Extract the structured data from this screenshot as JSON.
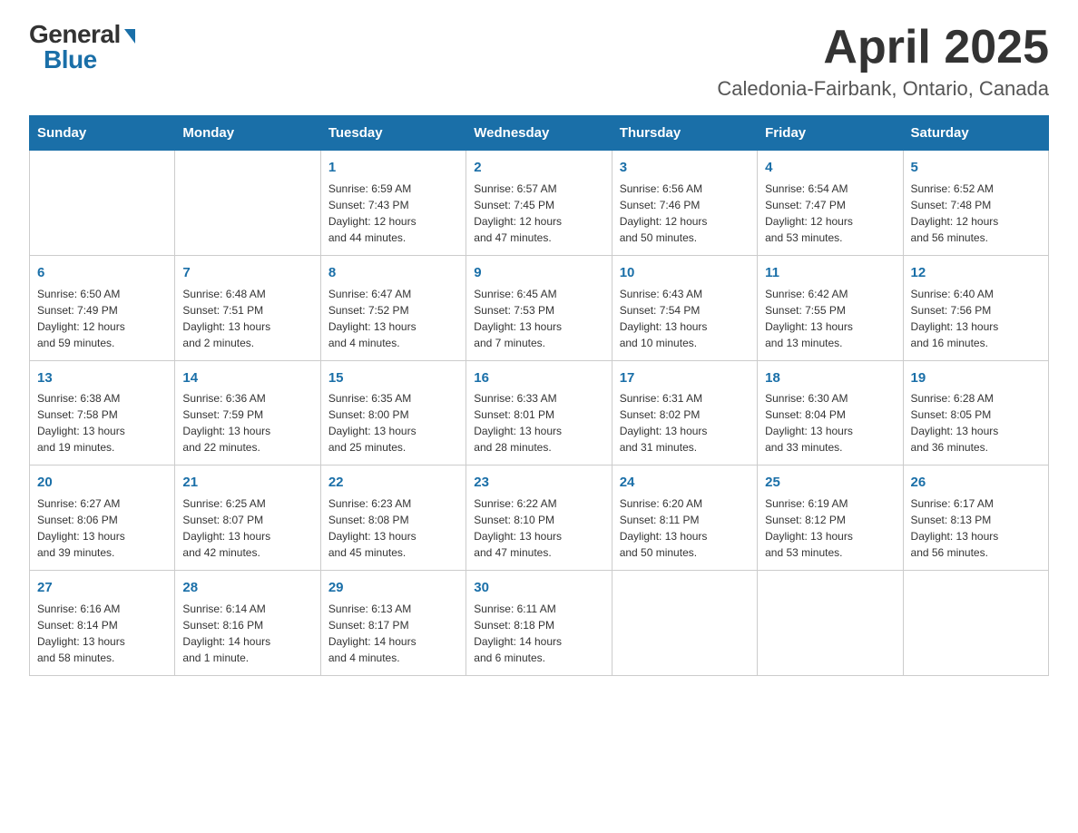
{
  "logo": {
    "general": "General",
    "blue": "Blue"
  },
  "title": "April 2025",
  "subtitle": "Caledonia-Fairbank, Ontario, Canada",
  "days_of_week": [
    "Sunday",
    "Monday",
    "Tuesday",
    "Wednesday",
    "Thursday",
    "Friday",
    "Saturday"
  ],
  "weeks": [
    [
      {
        "day": "",
        "info": ""
      },
      {
        "day": "",
        "info": ""
      },
      {
        "day": "1",
        "info": "Sunrise: 6:59 AM\nSunset: 7:43 PM\nDaylight: 12 hours\nand 44 minutes."
      },
      {
        "day": "2",
        "info": "Sunrise: 6:57 AM\nSunset: 7:45 PM\nDaylight: 12 hours\nand 47 minutes."
      },
      {
        "day": "3",
        "info": "Sunrise: 6:56 AM\nSunset: 7:46 PM\nDaylight: 12 hours\nand 50 minutes."
      },
      {
        "day": "4",
        "info": "Sunrise: 6:54 AM\nSunset: 7:47 PM\nDaylight: 12 hours\nand 53 minutes."
      },
      {
        "day": "5",
        "info": "Sunrise: 6:52 AM\nSunset: 7:48 PM\nDaylight: 12 hours\nand 56 minutes."
      }
    ],
    [
      {
        "day": "6",
        "info": "Sunrise: 6:50 AM\nSunset: 7:49 PM\nDaylight: 12 hours\nand 59 minutes."
      },
      {
        "day": "7",
        "info": "Sunrise: 6:48 AM\nSunset: 7:51 PM\nDaylight: 13 hours\nand 2 minutes."
      },
      {
        "day": "8",
        "info": "Sunrise: 6:47 AM\nSunset: 7:52 PM\nDaylight: 13 hours\nand 4 minutes."
      },
      {
        "day": "9",
        "info": "Sunrise: 6:45 AM\nSunset: 7:53 PM\nDaylight: 13 hours\nand 7 minutes."
      },
      {
        "day": "10",
        "info": "Sunrise: 6:43 AM\nSunset: 7:54 PM\nDaylight: 13 hours\nand 10 minutes."
      },
      {
        "day": "11",
        "info": "Sunrise: 6:42 AM\nSunset: 7:55 PM\nDaylight: 13 hours\nand 13 minutes."
      },
      {
        "day": "12",
        "info": "Sunrise: 6:40 AM\nSunset: 7:56 PM\nDaylight: 13 hours\nand 16 minutes."
      }
    ],
    [
      {
        "day": "13",
        "info": "Sunrise: 6:38 AM\nSunset: 7:58 PM\nDaylight: 13 hours\nand 19 minutes."
      },
      {
        "day": "14",
        "info": "Sunrise: 6:36 AM\nSunset: 7:59 PM\nDaylight: 13 hours\nand 22 minutes."
      },
      {
        "day": "15",
        "info": "Sunrise: 6:35 AM\nSunset: 8:00 PM\nDaylight: 13 hours\nand 25 minutes."
      },
      {
        "day": "16",
        "info": "Sunrise: 6:33 AM\nSunset: 8:01 PM\nDaylight: 13 hours\nand 28 minutes."
      },
      {
        "day": "17",
        "info": "Sunrise: 6:31 AM\nSunset: 8:02 PM\nDaylight: 13 hours\nand 31 minutes."
      },
      {
        "day": "18",
        "info": "Sunrise: 6:30 AM\nSunset: 8:04 PM\nDaylight: 13 hours\nand 33 minutes."
      },
      {
        "day": "19",
        "info": "Sunrise: 6:28 AM\nSunset: 8:05 PM\nDaylight: 13 hours\nand 36 minutes."
      }
    ],
    [
      {
        "day": "20",
        "info": "Sunrise: 6:27 AM\nSunset: 8:06 PM\nDaylight: 13 hours\nand 39 minutes."
      },
      {
        "day": "21",
        "info": "Sunrise: 6:25 AM\nSunset: 8:07 PM\nDaylight: 13 hours\nand 42 minutes."
      },
      {
        "day": "22",
        "info": "Sunrise: 6:23 AM\nSunset: 8:08 PM\nDaylight: 13 hours\nand 45 minutes."
      },
      {
        "day": "23",
        "info": "Sunrise: 6:22 AM\nSunset: 8:10 PM\nDaylight: 13 hours\nand 47 minutes."
      },
      {
        "day": "24",
        "info": "Sunrise: 6:20 AM\nSunset: 8:11 PM\nDaylight: 13 hours\nand 50 minutes."
      },
      {
        "day": "25",
        "info": "Sunrise: 6:19 AM\nSunset: 8:12 PM\nDaylight: 13 hours\nand 53 minutes."
      },
      {
        "day": "26",
        "info": "Sunrise: 6:17 AM\nSunset: 8:13 PM\nDaylight: 13 hours\nand 56 minutes."
      }
    ],
    [
      {
        "day": "27",
        "info": "Sunrise: 6:16 AM\nSunset: 8:14 PM\nDaylight: 13 hours\nand 58 minutes."
      },
      {
        "day": "28",
        "info": "Sunrise: 6:14 AM\nSunset: 8:16 PM\nDaylight: 14 hours\nand 1 minute."
      },
      {
        "day": "29",
        "info": "Sunrise: 6:13 AM\nSunset: 8:17 PM\nDaylight: 14 hours\nand 4 minutes."
      },
      {
        "day": "30",
        "info": "Sunrise: 6:11 AM\nSunset: 8:18 PM\nDaylight: 14 hours\nand 6 minutes."
      },
      {
        "day": "",
        "info": ""
      },
      {
        "day": "",
        "info": ""
      },
      {
        "day": "",
        "info": ""
      }
    ]
  ]
}
